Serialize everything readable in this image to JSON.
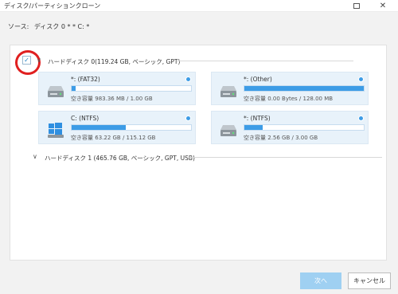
{
  "window": {
    "title": "ディスク/パーティションクローン",
    "minimize_glyph": "—",
    "close_glyph": "✕"
  },
  "source": {
    "label": "ソース:",
    "value": "ディスク 0 * * C: *"
  },
  "disks": [
    {
      "label": "ハードディスク 0(119.24 GB, ベーシック, GPT)",
      "checked": true,
      "expanded": true,
      "partitions": [
        {
          "name": "*: (FAT32)",
          "free_label": "空き容量",
          "free_value": "983.36 MB / 1.00 GB",
          "used_fraction": 0.03,
          "icon": "drive-icon"
        },
        {
          "name": "*: (Other)",
          "free_label": "空き容量",
          "free_value": "0.00 Bytes / 128.00 MB",
          "used_fraction": 1.0,
          "icon": "drive-icon"
        },
        {
          "name": "C: (NTFS)",
          "free_label": "空き容量",
          "free_value": "63.22 GB / 115.12 GB",
          "used_fraction": 0.45,
          "icon": "windows-drive-icon"
        },
        {
          "name": "*: (NTFS)",
          "free_label": "空き容量",
          "free_value": "2.56 GB / 3.00 GB",
          "used_fraction": 0.15,
          "icon": "drive-icon"
        }
      ]
    },
    {
      "label": "ハードディスク 1 (465.76 GB, ベーシック, GPT, USB)",
      "checked": false,
      "expanded": false,
      "partitions": []
    }
  ],
  "buttons": {
    "next": "次へ",
    "cancel": "キャンセル"
  },
  "colors": {
    "accent": "#3d9ce6",
    "card_bg": "#e8f2fa",
    "highlight_circle": "#e02020",
    "next_button": "#9fd0f2"
  }
}
